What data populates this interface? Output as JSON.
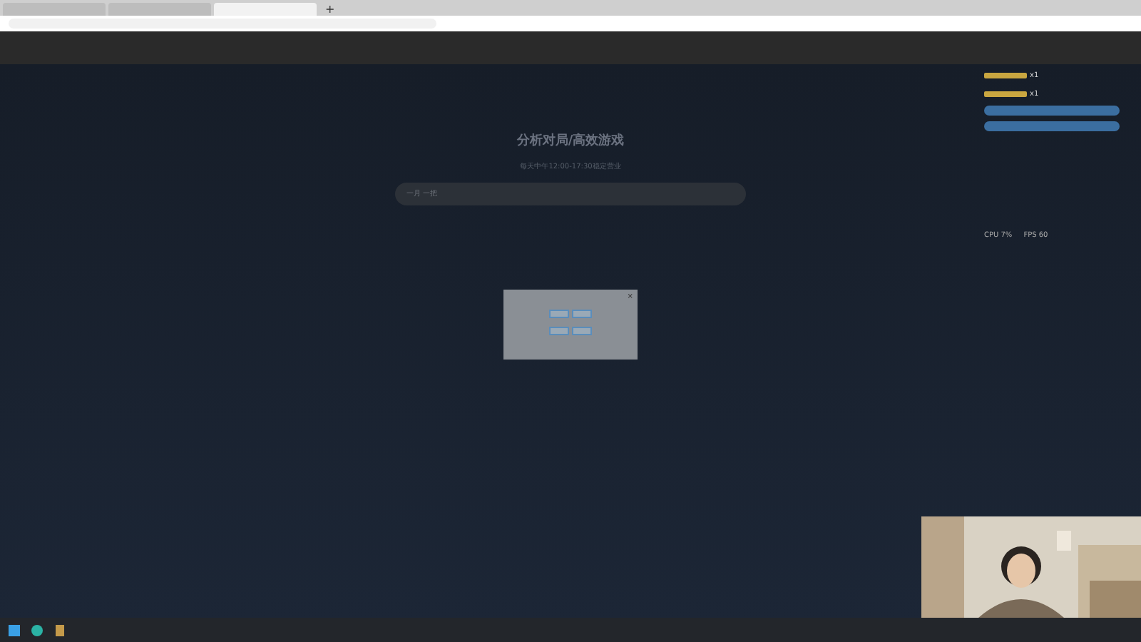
{
  "browser": {
    "tabs": [
      {
        "selected": false
      },
      {
        "selected": false
      },
      {
        "selected": true
      }
    ],
    "new_tab": "+"
  },
  "page": {
    "heading": "分析对局/高效游戏",
    "subtitle": "每天中午12:00-17:30稳定营业",
    "search": {
      "placeholder": "一月 一把"
    }
  },
  "dialog": {
    "close": "×",
    "rows": [
      {
        "buttons": [
          {
            "kind": "button"
          },
          {
            "kind": "button"
          }
        ]
      },
      {
        "buttons": [
          {
            "kind": "button"
          },
          {
            "kind": "button"
          }
        ]
      }
    ]
  },
  "chat": {
    "gifts": [
      {
        "count": "x1"
      },
      {
        "count": "x1"
      }
    ],
    "stats": [
      {
        "text": "CPU 7%"
      },
      {
        "text": "FPS 60"
      }
    ]
  }
}
